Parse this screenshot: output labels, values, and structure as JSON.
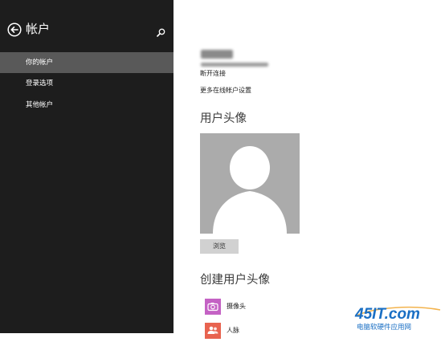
{
  "sidebar": {
    "title": "帐户",
    "back_icon": "back-arrow-circle-icon",
    "search_icon": "search-icon",
    "items": [
      {
        "label": "你的帐户",
        "selected": true
      },
      {
        "label": "登录选项",
        "selected": false
      },
      {
        "label": "其他帐户",
        "selected": false
      }
    ]
  },
  "main": {
    "disconnect_link": "断开连接",
    "more_settings_link": "更多在线帐户设置",
    "avatar_heading": "用户头像",
    "avatar_icon": "default-user-silhouette-icon",
    "browse_button": "浏览",
    "create_heading": "创建用户头像",
    "apps": [
      {
        "label": "摄像头",
        "icon": "camera-icon",
        "color": "#c462c4"
      },
      {
        "label": "人脉",
        "icon": "people-icon",
        "color": "#e8634f"
      }
    ]
  },
  "watermark": {
    "logo": "45IT.com",
    "tagline": "电脑软硬件应用网"
  },
  "colors": {
    "sidebar_bg": "#1d1d1d",
    "sidebar_selected": "#595959",
    "avatar_bg": "#ababab",
    "button_bg": "#d1d1d1",
    "watermark_blue": "#1a6fc4"
  }
}
